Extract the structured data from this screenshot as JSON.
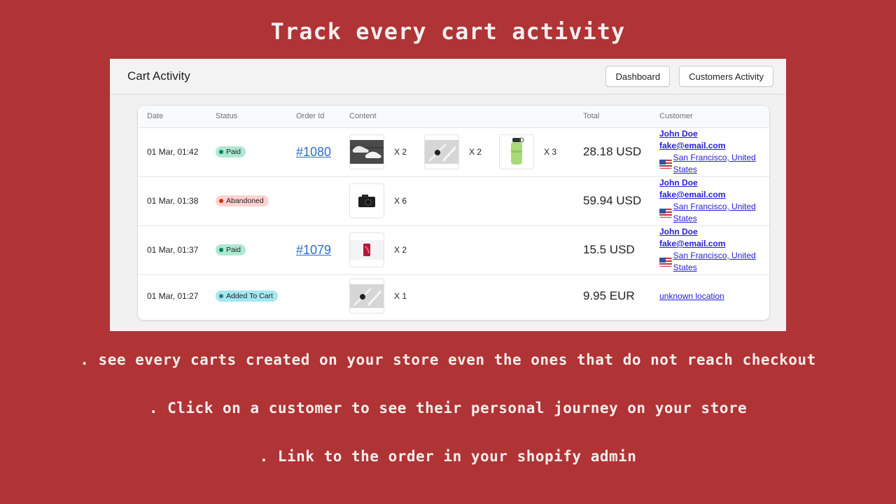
{
  "headline": "Track every cart activity",
  "bullets": [
    ". see every carts created on your store even the ones that do not reach checkout",
    ". Click on a customer to see their personal journey on your store",
    ". Link to the order in your shopify admin"
  ],
  "panel": {
    "title": "Cart Activity",
    "buttons": {
      "dashboard": "Dashboard",
      "customers_activity": "Customers Activity"
    }
  },
  "table": {
    "headers": [
      "Date",
      "Status",
      "Order Id",
      "Content",
      "Total",
      "Customer"
    ],
    "rows": [
      {
        "date": "01 Mar, 01:42",
        "status": "Paid",
        "order_id": "#1080",
        "items": [
          {
            "product": "sneakers",
            "qty": "X 2"
          },
          {
            "product": "smartwatch",
            "qty": "X 2"
          },
          {
            "product": "water-bottle",
            "qty": "X 3"
          }
        ],
        "total": "28.18 USD",
        "customer": {
          "name": "John Doe",
          "email": "fake@email.com",
          "location": " San Francisco, United States",
          "flag": "us-flag"
        }
      },
      {
        "date": "01 Mar, 01:38",
        "status": "Abandoned",
        "order_id": "",
        "items": [
          {
            "product": "camera",
            "qty": "X 6"
          }
        ],
        "total": "59.94 USD",
        "customer": {
          "name": "John Doe",
          "email": "fake@email.com",
          "location": " San Francisco, United States",
          "flag": "us-flag"
        }
      },
      {
        "date": "01 Mar, 01:37",
        "status": "Paid",
        "order_id": "#1079",
        "items": [
          {
            "product": "phone",
            "qty": "X 2"
          }
        ],
        "total": "15.5 USD",
        "customer": {
          "name": "John Doe",
          "email": "fake@email.com",
          "location": " San Francisco, United States",
          "flag": "us-flag"
        }
      },
      {
        "date": "01 Mar, 01:27",
        "status": "Added To Cart",
        "order_id": "",
        "items": [
          {
            "product": "smartwatch",
            "qty": "X 1"
          }
        ],
        "total": "9.95 EUR",
        "customer": {
          "unknown": "unknown location"
        }
      }
    ]
  },
  "colors": {
    "background": "#b03335",
    "paid_badge": "#aee9d1",
    "abandoned_badge": "#fed3d1",
    "added_badge": "#a4e8f2",
    "order_link": "#2c6ecb"
  }
}
